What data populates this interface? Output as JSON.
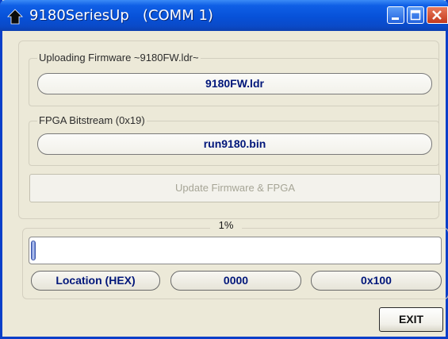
{
  "window": {
    "title": "9180SeriesUp   (COMM 1)",
    "controls": {
      "minimize": "minimize-icon",
      "maximize": "maximize-icon",
      "close": "close-icon"
    },
    "accent": "#0a4ac8",
    "close_color": "#c4391c"
  },
  "firmware": {
    "group_label": "Uploading Firmware ~9180FW.ldr~",
    "file": "9180FW.ldr"
  },
  "fpga": {
    "group_label": "FPGA Bitstream (0x19)",
    "file": "run9180.bin"
  },
  "update_button": {
    "label": "Update Firmware & FPGA",
    "enabled": false
  },
  "progress": {
    "percent_label": "1%",
    "value": 0.01
  },
  "location": {
    "label": "Location (HEX)",
    "current": "0000",
    "end": "0x100"
  },
  "exit_button": {
    "label": "EXIT"
  }
}
